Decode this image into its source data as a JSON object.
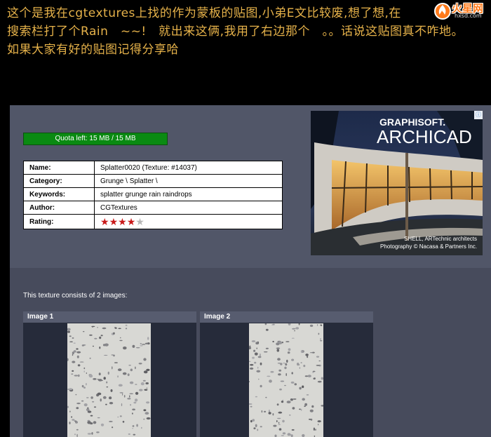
{
  "caption": {
    "line1": "这个是我在cgtextures上找的作为蒙板的贴图,小弟E文比较废,想了想,在",
    "line2": "搜索栏打了个Rain　~~!　就出来这俩,我用了右边那个　。。话说这贴图真不咋地。",
    "line3": "如果大家有好的贴图记得分享哈"
  },
  "watermark": {
    "name": "火星网",
    "url": "hxsd.com"
  },
  "quota": {
    "label": "Quota left: 15 MB / 15 MB",
    "fraction": 1.0
  },
  "info": {
    "rows": [
      {
        "key": "Name:",
        "value": "Splatter0020 (Texture: #14037)"
      },
      {
        "key": "Category:",
        "value": "Grunge \\ Splatter \\"
      },
      {
        "key": "Keywords:",
        "value": "splatter grunge rain raindrops"
      },
      {
        "key": "Author:",
        "value": "CGTextures"
      }
    ],
    "rating_key": "Rating:",
    "rating_value": 4,
    "rating_max": 5
  },
  "ad": {
    "brand": "GRAPHISOFT.",
    "product": "ARCHICAD",
    "credit1": "SHELL, ARTechnic architects",
    "credit2": "Photography © Nacasa & Partners Inc.",
    "corner": "ⓘ"
  },
  "texture": {
    "consists": "This texture consists of 2 images:",
    "images": [
      {
        "label": "Image 1"
      },
      {
        "label": "Image 2"
      }
    ]
  },
  "colors": {
    "caption": "#e6b24a",
    "panel": "#515668",
    "quota_green": "#0a8a12",
    "star": "#c91a1a"
  }
}
